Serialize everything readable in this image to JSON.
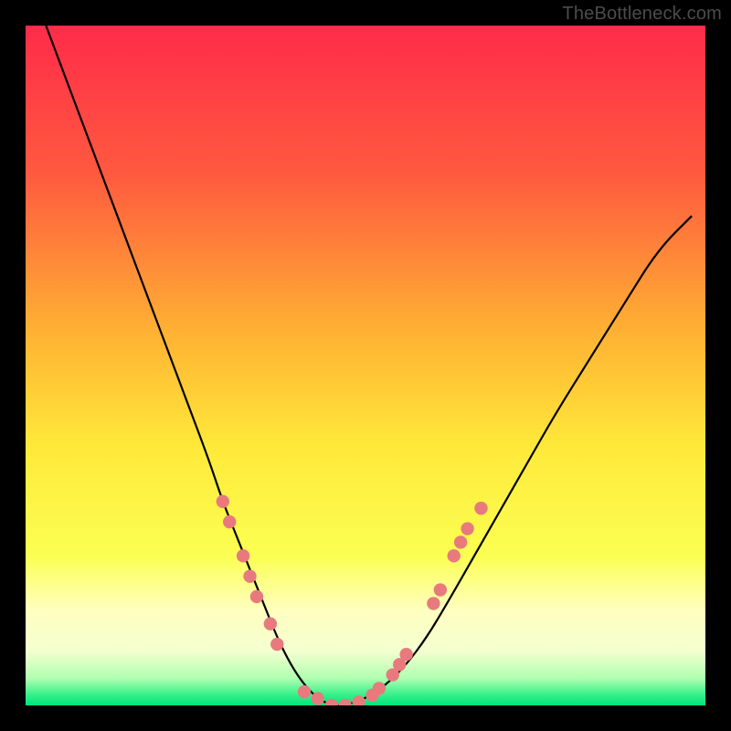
{
  "watermark": "TheBottleneck.com",
  "colors": {
    "frame": "#000000",
    "curve": "#000000",
    "marker_fill": "#e87a7e",
    "marker_stroke": "#c85a5e",
    "gradient_top": "#ff2b4a",
    "gradient_mid_upper": "#ffb133",
    "gradient_mid": "#ffe93a",
    "gradient_pale": "#ffffbf",
    "gradient_bottom": "#00e57a"
  },
  "chart_data": {
    "type": "line",
    "title": "",
    "xlabel": "",
    "ylabel": "",
    "xlim": [
      0,
      100
    ],
    "ylim": [
      0,
      100
    ],
    "series": [
      {
        "name": "bottleneck-curve",
        "x": [
          3,
          6,
          9,
          12,
          15,
          18,
          21,
          24,
          27,
          29,
          31,
          33,
          35,
          37,
          39,
          41,
          43,
          45,
          47,
          50,
          53,
          56,
          59,
          62,
          66,
          70,
          74,
          78,
          83,
          88,
          93,
          98
        ],
        "y": [
          100,
          92,
          84,
          76,
          68,
          60,
          52,
          44,
          36,
          30,
          25,
          20,
          15,
          10,
          6,
          3,
          1,
          0,
          0,
          1,
          3,
          6,
          10,
          15,
          22,
          29,
          36,
          43,
          51,
          59,
          67,
          72
        ]
      }
    ],
    "markers": {
      "name": "highlight-points",
      "points": [
        {
          "x": 29,
          "y": 30
        },
        {
          "x": 30,
          "y": 27
        },
        {
          "x": 32,
          "y": 22
        },
        {
          "x": 33,
          "y": 19
        },
        {
          "x": 34,
          "y": 16
        },
        {
          "x": 36,
          "y": 12
        },
        {
          "x": 37,
          "y": 9
        },
        {
          "x": 41,
          "y": 2
        },
        {
          "x": 43,
          "y": 1
        },
        {
          "x": 45,
          "y": 0
        },
        {
          "x": 47,
          "y": 0
        },
        {
          "x": 49,
          "y": 0.5
        },
        {
          "x": 51,
          "y": 1.5
        },
        {
          "x": 52,
          "y": 2.5
        },
        {
          "x": 54,
          "y": 4.5
        },
        {
          "x": 55,
          "y": 6
        },
        {
          "x": 56,
          "y": 7.5
        },
        {
          "x": 60,
          "y": 15
        },
        {
          "x": 61,
          "y": 17
        },
        {
          "x": 63,
          "y": 22
        },
        {
          "x": 64,
          "y": 24
        },
        {
          "x": 65,
          "y": 26
        },
        {
          "x": 67,
          "y": 29
        }
      ]
    },
    "bands": [
      {
        "name": "green",
        "y0": 0,
        "y1": 3
      },
      {
        "name": "pale",
        "y0": 3,
        "y1": 18
      },
      {
        "name": "yellow",
        "y0": 18,
        "y1": 55
      },
      {
        "name": "orange",
        "y0": 55,
        "y1": 80
      },
      {
        "name": "red",
        "y0": 80,
        "y1": 100
      }
    ]
  }
}
